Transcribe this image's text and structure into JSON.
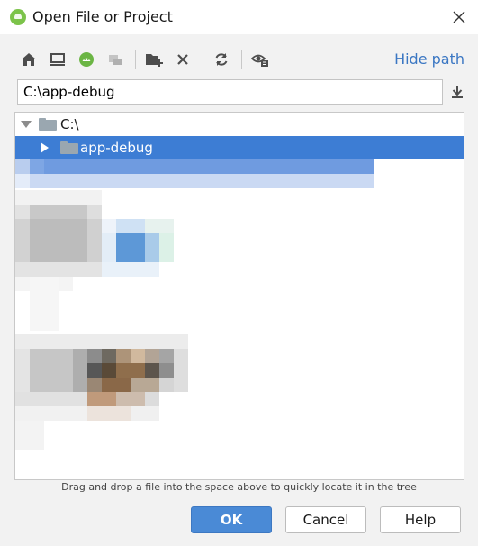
{
  "window": {
    "title": "Open File or Project",
    "close_icon": "close-icon"
  },
  "toolbar": {
    "icons": [
      "home-icon",
      "desktop-icon",
      "android-project-icon",
      "module-icon",
      "new-folder-icon",
      "delete-icon",
      "refresh-icon",
      "show-hidden-icon"
    ],
    "hide_path_label": "Hide path"
  },
  "path": {
    "value": "C:\\app-debug"
  },
  "tree": {
    "root_label": "C:\\",
    "selected_label": "app-debug"
  },
  "hint": "Drag and drop a file into the space above to quickly locate it in the tree",
  "buttons": {
    "ok": "OK",
    "cancel": "Cancel",
    "help": "Help"
  },
  "colors": {
    "selection": "#3d7dd4",
    "accent": "#4a8ad6",
    "link": "#3b77c3"
  }
}
